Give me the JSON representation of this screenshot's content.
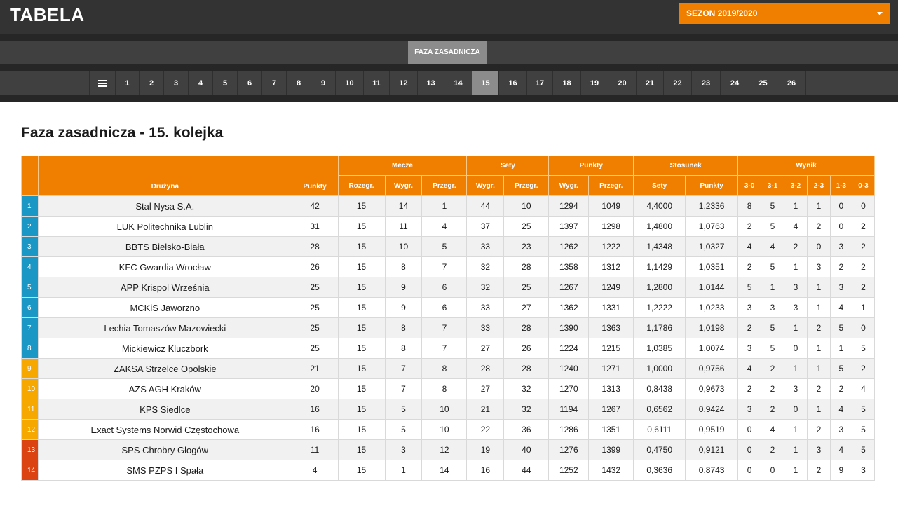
{
  "header": {
    "title": "TABELA",
    "season_label": "SEZON 2019/2020"
  },
  "phase_tab": "FAZA ZASADNICZA",
  "rounds": {
    "menu_icon": "hamburger-menu-icon",
    "items": [
      "1",
      "2",
      "3",
      "4",
      "5",
      "6",
      "7",
      "8",
      "9",
      "10",
      "11",
      "12",
      "13",
      "14",
      "15",
      "16",
      "17",
      "18",
      "19",
      "20",
      "21",
      "22",
      "23",
      "24",
      "25",
      "26"
    ],
    "active": "15"
  },
  "page_heading": "Faza zasadnicza - 15. kolejka",
  "table": {
    "group_headers": {
      "team": "Drużyna",
      "points": "Punkty",
      "matches": "Mecze",
      "sets": "Sety",
      "points_group": "Punkty",
      "ratio": "Stosunek",
      "result": "Wynik"
    },
    "sub_headers": [
      "Rozegr.",
      "Wygr.",
      "Przegr.",
      "Wygr.",
      "Przegr.",
      "Wygr.",
      "Przegr.",
      "Sety",
      "Punkty",
      "3-0",
      "3-1",
      "3-2",
      "2-3",
      "1-3",
      "0-3"
    ],
    "status_colors": {
      "blue": "#1a97c4",
      "yellow": "#f7a800",
      "red": "#dc4313"
    },
    "rows": [
      {
        "pos": "1",
        "status": "blue",
        "team": "Stal Nysa S.A.",
        "pts": "42",
        "played": "15",
        "won": "14",
        "lost": "1",
        "sets_won": "44",
        "sets_lost": "10",
        "pts_won": "1294",
        "pts_lost": "1049",
        "ratio_sets": "4,4000",
        "ratio_pts": "1,2336",
        "r30": "8",
        "r31": "5",
        "r32": "1",
        "r23": "1",
        "r13": "0",
        "r03": "0"
      },
      {
        "pos": "2",
        "status": "blue",
        "team": "LUK Politechnika Lublin",
        "pts": "31",
        "played": "15",
        "won": "11",
        "lost": "4",
        "sets_won": "37",
        "sets_lost": "25",
        "pts_won": "1397",
        "pts_lost": "1298",
        "ratio_sets": "1,4800",
        "ratio_pts": "1,0763",
        "r30": "2",
        "r31": "5",
        "r32": "4",
        "r23": "2",
        "r13": "0",
        "r03": "2"
      },
      {
        "pos": "3",
        "status": "blue",
        "team": "BBTS Bielsko-Biała",
        "pts": "28",
        "played": "15",
        "won": "10",
        "lost": "5",
        "sets_won": "33",
        "sets_lost": "23",
        "pts_won": "1262",
        "pts_lost": "1222",
        "ratio_sets": "1,4348",
        "ratio_pts": "1,0327",
        "r30": "4",
        "r31": "4",
        "r32": "2",
        "r23": "0",
        "r13": "3",
        "r03": "2"
      },
      {
        "pos": "4",
        "status": "blue",
        "team": "KFC Gwardia Wrocław",
        "pts": "26",
        "played": "15",
        "won": "8",
        "lost": "7",
        "sets_won": "32",
        "sets_lost": "28",
        "pts_won": "1358",
        "pts_lost": "1312",
        "ratio_sets": "1,1429",
        "ratio_pts": "1,0351",
        "r30": "2",
        "r31": "5",
        "r32": "1",
        "r23": "3",
        "r13": "2",
        "r03": "2"
      },
      {
        "pos": "5",
        "status": "blue",
        "team": "APP Krispol Września",
        "pts": "25",
        "played": "15",
        "won": "9",
        "lost": "6",
        "sets_won": "32",
        "sets_lost": "25",
        "pts_won": "1267",
        "pts_lost": "1249",
        "ratio_sets": "1,2800",
        "ratio_pts": "1,0144",
        "r30": "5",
        "r31": "1",
        "r32": "3",
        "r23": "1",
        "r13": "3",
        "r03": "2"
      },
      {
        "pos": "6",
        "status": "blue",
        "team": "MCKiS Jaworzno",
        "pts": "25",
        "played": "15",
        "won": "9",
        "lost": "6",
        "sets_won": "33",
        "sets_lost": "27",
        "pts_won": "1362",
        "pts_lost": "1331",
        "ratio_sets": "1,2222",
        "ratio_pts": "1,0233",
        "r30": "3",
        "r31": "3",
        "r32": "3",
        "r23": "1",
        "r13": "4",
        "r03": "1"
      },
      {
        "pos": "7",
        "status": "blue",
        "team": "Lechia Tomaszów Mazowiecki",
        "pts": "25",
        "played": "15",
        "won": "8",
        "lost": "7",
        "sets_won": "33",
        "sets_lost": "28",
        "pts_won": "1390",
        "pts_lost": "1363",
        "ratio_sets": "1,1786",
        "ratio_pts": "1,0198",
        "r30": "2",
        "r31": "5",
        "r32": "1",
        "r23": "2",
        "r13": "5",
        "r03": "0"
      },
      {
        "pos": "8",
        "status": "blue",
        "team": "Mickiewicz Kluczbork",
        "pts": "25",
        "played": "15",
        "won": "8",
        "lost": "7",
        "sets_won": "27",
        "sets_lost": "26",
        "pts_won": "1224",
        "pts_lost": "1215",
        "ratio_sets": "1,0385",
        "ratio_pts": "1,0074",
        "r30": "3",
        "r31": "5",
        "r32": "0",
        "r23": "1",
        "r13": "1",
        "r03": "5"
      },
      {
        "pos": "9",
        "status": "yellow",
        "team": "ZAKSA Strzelce Opolskie",
        "pts": "21",
        "played": "15",
        "won": "7",
        "lost": "8",
        "sets_won": "28",
        "sets_lost": "28",
        "pts_won": "1240",
        "pts_lost": "1271",
        "ratio_sets": "1,0000",
        "ratio_pts": "0,9756",
        "r30": "4",
        "r31": "2",
        "r32": "1",
        "r23": "1",
        "r13": "5",
        "r03": "2"
      },
      {
        "pos": "10",
        "status": "yellow",
        "team": "AZS AGH Kraków",
        "pts": "20",
        "played": "15",
        "won": "7",
        "lost": "8",
        "sets_won": "27",
        "sets_lost": "32",
        "pts_won": "1270",
        "pts_lost": "1313",
        "ratio_sets": "0,8438",
        "ratio_pts": "0,9673",
        "r30": "2",
        "r31": "2",
        "r32": "3",
        "r23": "2",
        "r13": "2",
        "r03": "4"
      },
      {
        "pos": "11",
        "status": "yellow",
        "team": "KPS Siedlce",
        "pts": "16",
        "played": "15",
        "won": "5",
        "lost": "10",
        "sets_won": "21",
        "sets_lost": "32",
        "pts_won": "1194",
        "pts_lost": "1267",
        "ratio_sets": "0,6562",
        "ratio_pts": "0,9424",
        "r30": "3",
        "r31": "2",
        "r32": "0",
        "r23": "1",
        "r13": "4",
        "r03": "5"
      },
      {
        "pos": "12",
        "status": "yellow",
        "team": "Exact Systems Norwid Częstochowa",
        "pts": "16",
        "played": "15",
        "won": "5",
        "lost": "10",
        "sets_won": "22",
        "sets_lost": "36",
        "pts_won": "1286",
        "pts_lost": "1351",
        "ratio_sets": "0,6111",
        "ratio_pts": "0,9519",
        "r30": "0",
        "r31": "4",
        "r32": "1",
        "r23": "2",
        "r13": "3",
        "r03": "5"
      },
      {
        "pos": "13",
        "status": "red",
        "team": "SPS Chrobry Głogów",
        "pts": "11",
        "played": "15",
        "won": "3",
        "lost": "12",
        "sets_won": "19",
        "sets_lost": "40",
        "pts_won": "1276",
        "pts_lost": "1399",
        "ratio_sets": "0,4750",
        "ratio_pts": "0,9121",
        "r30": "0",
        "r31": "2",
        "r32": "1",
        "r23": "3",
        "r13": "4",
        "r03": "5"
      },
      {
        "pos": "14",
        "status": "red",
        "team": "SMS PZPS I Spała",
        "pts": "4",
        "played": "15",
        "won": "1",
        "lost": "14",
        "sets_won": "16",
        "sets_lost": "44",
        "pts_won": "1252",
        "pts_lost": "1432",
        "ratio_sets": "0,3636",
        "ratio_pts": "0,8743",
        "r30": "0",
        "r31": "0",
        "r32": "1",
        "r23": "2",
        "r13": "9",
        "r03": "3"
      }
    ]
  }
}
